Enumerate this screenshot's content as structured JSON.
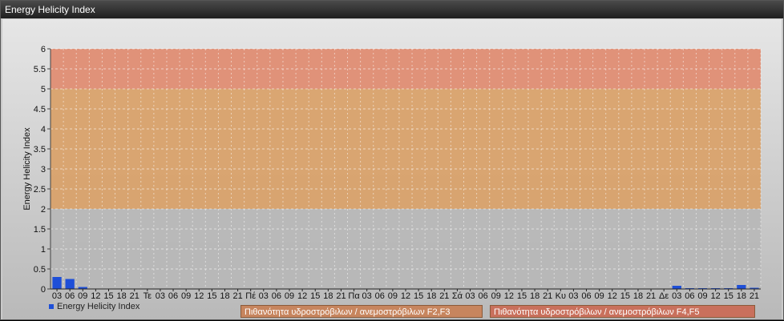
{
  "window": {
    "title": "Energy Helicity Index"
  },
  "colors": {
    "bar": "#1e4fd8",
    "band_low": "#b7b7b7",
    "band_mid": "#d9a066",
    "band_high": "#e08a6e",
    "legend_f2f3": "#c7855e",
    "legend_f4f5": "#c9705c"
  },
  "legend": {
    "series_label": "Energy Helicity Index",
    "band_f2f3": "Πιθανότητα υδροστρόβιλων / ανεμοστρόβιλων F2,F3",
    "band_f4f5": "Πιθανότητα υδροστρόβιλων / ανεμοστρόβιλων F4,F5"
  },
  "chart_data": {
    "type": "bar",
    "title": "",
    "ylabel": "Energy Helicity Index",
    "xlabel": "",
    "ylim": [
      0,
      6
    ],
    "yticks": [
      "0",
      "0.5",
      "1",
      "1.5",
      "2",
      "2.5",
      "3",
      "3.5",
      "4",
      "4.5",
      "5",
      "5.5",
      "6"
    ],
    "grid": true,
    "bands": [
      {
        "from": 0,
        "to": 2,
        "level": "low"
      },
      {
        "from": 2,
        "to": 5,
        "level": "F2,F3"
      },
      {
        "from": 5,
        "to": 6,
        "level": "F4,F5"
      }
    ],
    "categories": [
      "03",
      "06",
      "09",
      "12",
      "15",
      "18",
      "21",
      "Τε",
      "03",
      "06",
      "09",
      "12",
      "15",
      "18",
      "21",
      "Πέ",
      "03",
      "06",
      "09",
      "12",
      "15",
      "18",
      "21",
      "Πα",
      "03",
      "06",
      "09",
      "12",
      "15",
      "18",
      "21",
      "Σά",
      "03",
      "06",
      "09",
      "12",
      "15",
      "18",
      "21",
      "Κυ",
      "03",
      "06",
      "09",
      "12",
      "15",
      "18",
      "21",
      "Δε",
      "03",
      "06",
      "09",
      "12",
      "15",
      "18",
      "21"
    ],
    "series": [
      {
        "name": "Energy Helicity Index",
        "values": [
          0.3,
          0.25,
          0.05,
          0.01,
          0.01,
          0.01,
          0.01,
          0.01,
          0.01,
          0.01,
          0.01,
          0.01,
          0.01,
          0.01,
          0.01,
          0.01,
          0.01,
          0.01,
          0.01,
          0.01,
          0.01,
          0.01,
          0.01,
          0.01,
          0.01,
          0.01,
          0.01,
          0.01,
          0.01,
          0.01,
          0.01,
          0.01,
          0.01,
          0.01,
          0.01,
          0.01,
          0.01,
          0.01,
          0.01,
          0.01,
          0.01,
          0.01,
          0.01,
          0.01,
          0.01,
          0.01,
          0.01,
          0.01,
          0.08,
          0.02,
          0.02,
          0.02,
          0.02,
          0.1,
          0.03
        ]
      }
    ]
  }
}
